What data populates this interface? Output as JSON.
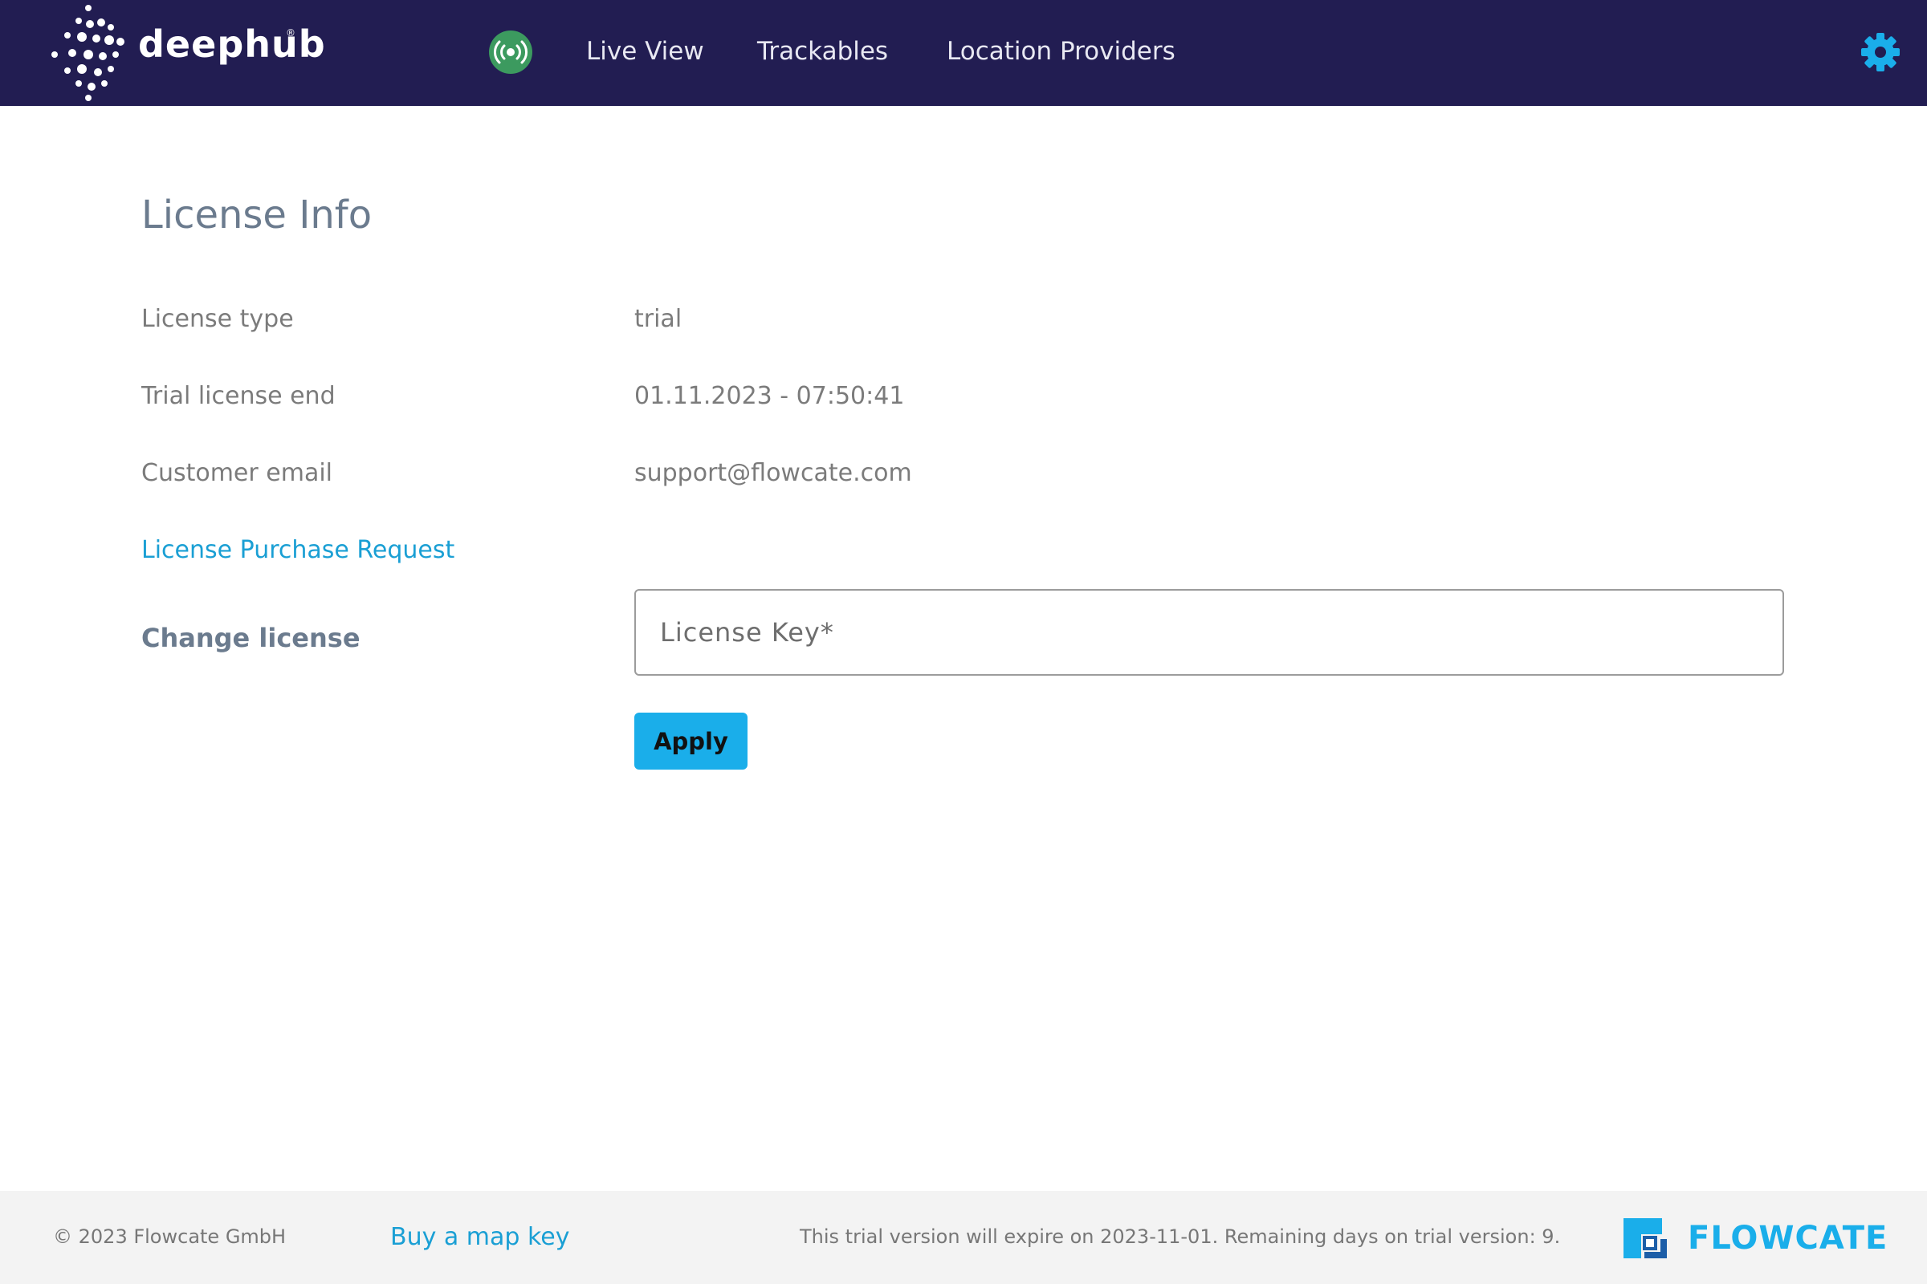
{
  "header": {
    "logo_text": "deephub",
    "logo_reg": "®",
    "nav": [
      {
        "label": "Live View"
      },
      {
        "label": "Trackables"
      },
      {
        "label": "Location Providers"
      }
    ]
  },
  "main": {
    "title": "License Info",
    "rows": [
      {
        "label": "License type",
        "value": "trial"
      },
      {
        "label": "Trial license end",
        "value": "01.11.2023 - 07:50:41"
      },
      {
        "label": "Customer email",
        "value": "support@flowcate.com"
      }
    ],
    "purchase_link": "License Purchase Request",
    "change_label": "Change license",
    "license_input": {
      "placeholder": "License Key*",
      "value": ""
    },
    "apply_label": "Apply"
  },
  "footer": {
    "copyright": "© 2023 Flowcate GmbH",
    "buy_map_key": "Buy a map key",
    "trial_notice": "This trial version will expire on 2023-11-01. Remaining days on trial version: 9.",
    "brand_text": "FLOWCATE"
  },
  "icons": {
    "live": "broadcast-icon",
    "settings": "gear-icon",
    "brand": "flowcate-logo-icon"
  },
  "colors": {
    "header_bg": "#221d52",
    "accent": "#1aaeea",
    "link": "#1a9fd4",
    "live_green": "#3c9a5f",
    "footer_bg": "#f3f3f3"
  }
}
